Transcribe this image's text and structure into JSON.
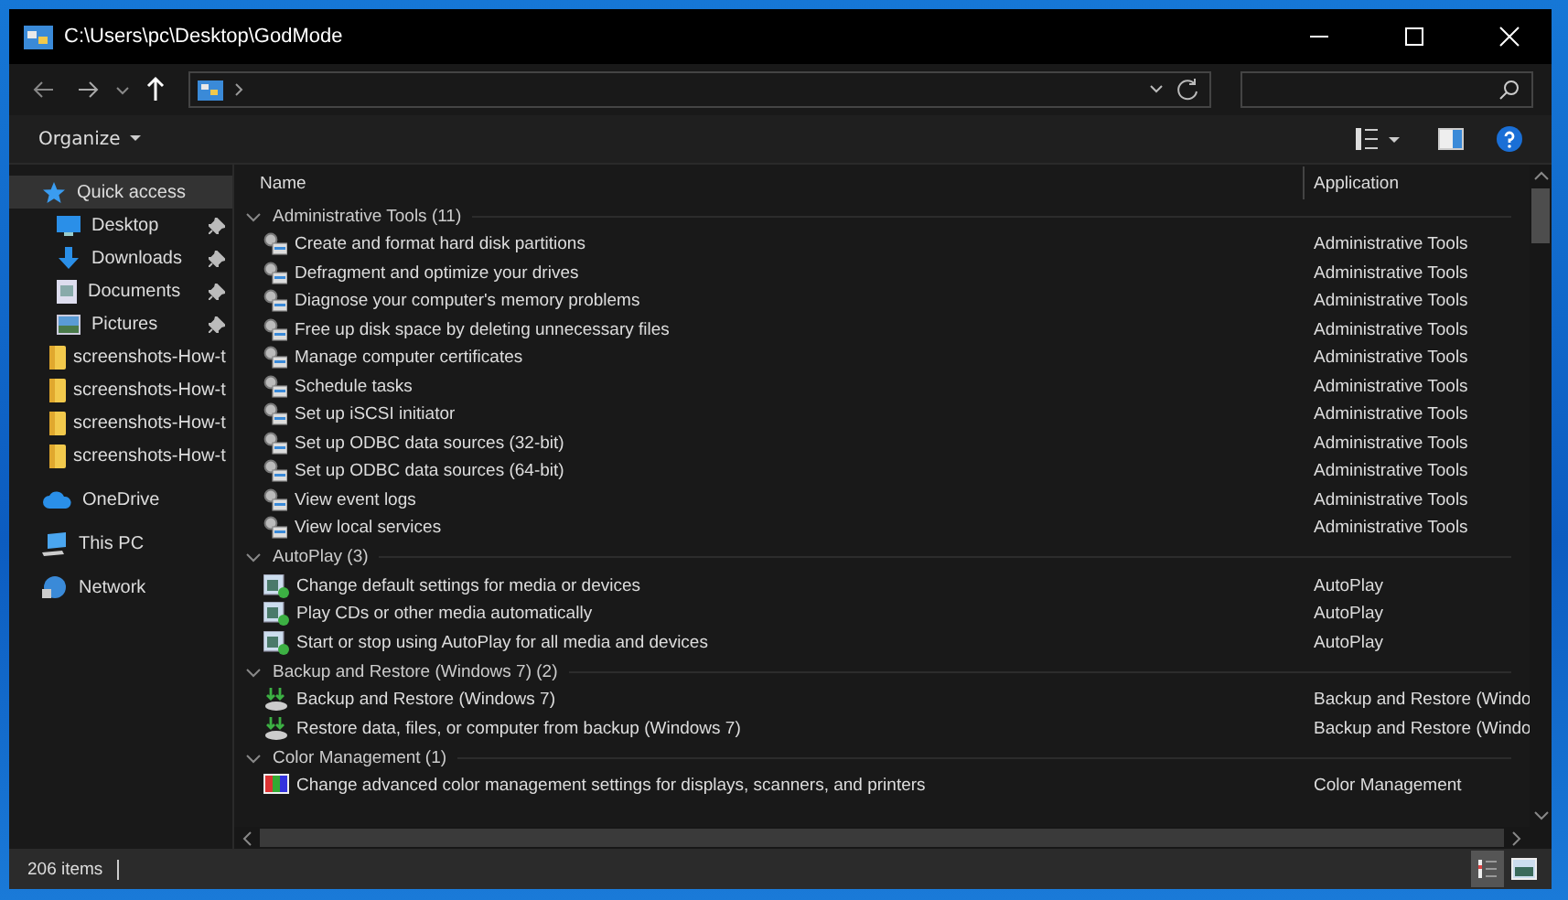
{
  "window": {
    "title": "C:\\Users\\pc\\Desktop\\GodMode"
  },
  "toolbar": {
    "organize": "Organize"
  },
  "sidebar": {
    "items": [
      {
        "label": "Quick access",
        "kind": "star",
        "pinned": false,
        "selected": true
      },
      {
        "label": "Desktop",
        "kind": "desktop",
        "pinned": true,
        "selected": false
      },
      {
        "label": "Downloads",
        "kind": "download",
        "pinned": true,
        "selected": false
      },
      {
        "label": "Documents",
        "kind": "document",
        "pinned": true,
        "selected": false
      },
      {
        "label": "Pictures",
        "kind": "picture",
        "pinned": true,
        "selected": false
      },
      {
        "label": "screenshots-How-t",
        "kind": "folder",
        "pinned": false,
        "selected": false
      },
      {
        "label": "screenshots-How-t",
        "kind": "folder",
        "pinned": false,
        "selected": false
      },
      {
        "label": "screenshots-How-t",
        "kind": "folder",
        "pinned": false,
        "selected": false
      },
      {
        "label": "screenshots-How-t",
        "kind": "folder",
        "pinned": false,
        "selected": false
      },
      {
        "label": "OneDrive",
        "kind": "cloud",
        "pinned": false,
        "selected": false
      },
      {
        "label": "This PC",
        "kind": "pc",
        "pinned": false,
        "selected": false
      },
      {
        "label": "Network",
        "kind": "network",
        "pinned": false,
        "selected": false
      }
    ]
  },
  "table": {
    "columns": [
      "Name",
      "Application"
    ],
    "groups": [
      {
        "title": "Administrative Tools (11)",
        "kind": "admin",
        "expanded": true,
        "items": [
          {
            "name": "Create and format hard disk partitions",
            "application": "Administrative Tools"
          },
          {
            "name": "Defragment and optimize your drives",
            "application": "Administrative Tools"
          },
          {
            "name": "Diagnose your computer's memory problems",
            "application": "Administrative Tools"
          },
          {
            "name": "Free up disk space by deleting unnecessary files",
            "application": "Administrative Tools"
          },
          {
            "name": "Manage computer certificates",
            "application": "Administrative Tools"
          },
          {
            "name": "Schedule tasks",
            "application": "Administrative Tools"
          },
          {
            "name": "Set up iSCSI initiator",
            "application": "Administrative Tools"
          },
          {
            "name": "Set up ODBC data sources (32-bit)",
            "application": "Administrative Tools"
          },
          {
            "name": "Set up ODBC data sources (64-bit)",
            "application": "Administrative Tools"
          },
          {
            "name": "View event logs",
            "application": "Administrative Tools"
          },
          {
            "name": "View local services",
            "application": "Administrative Tools"
          }
        ]
      },
      {
        "title": "AutoPlay (3)",
        "kind": "autoplay",
        "expanded": true,
        "items": [
          {
            "name": "Change default settings for media or devices",
            "application": "AutoPlay"
          },
          {
            "name": "Play CDs or other media automatically",
            "application": "AutoPlay"
          },
          {
            "name": "Start or stop using AutoPlay for all media and devices",
            "application": "AutoPlay"
          }
        ]
      },
      {
        "title": "Backup and Restore (Windows 7) (2)",
        "kind": "backup",
        "expanded": true,
        "items": [
          {
            "name": "Backup and Restore (Windows 7)",
            "application": "Backup and Restore (Windo"
          },
          {
            "name": "Restore data, files, or computer from backup (Windows 7)",
            "application": "Backup and Restore (Windo"
          }
        ]
      },
      {
        "title": "Color Management (1)",
        "kind": "color",
        "expanded": true,
        "items": [
          {
            "name": "Change advanced color management settings for displays, scanners, and printers",
            "application": "Color Management"
          }
        ]
      }
    ]
  },
  "status_bar": {
    "count": "206 items"
  },
  "views": [
    {
      "kind": "details",
      "selected": true
    },
    {
      "kind": "tiles",
      "selected": false
    }
  ]
}
